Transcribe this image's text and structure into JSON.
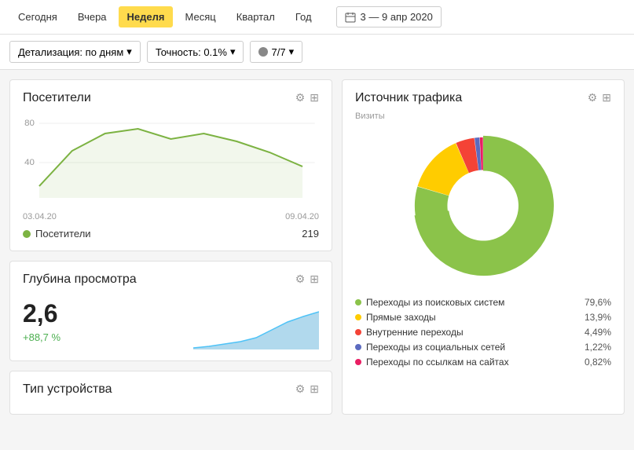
{
  "topbar": {
    "periods": [
      {
        "label": "Сегодня",
        "active": false
      },
      {
        "label": "Вчера",
        "active": false
      },
      {
        "label": "Неделя",
        "active": true
      },
      {
        "label": "Месяц",
        "active": false
      },
      {
        "label": "Квартал",
        "active": false
      },
      {
        "label": "Год",
        "active": false
      }
    ],
    "dateRange": "3 — 9 апр 2020"
  },
  "secondbar": {
    "detail": "Детализация: по дням",
    "accuracy": "Точность: 0.1%",
    "sites": "7/7"
  },
  "visitors": {
    "title": "Посетители",
    "count": "219",
    "legendLabel": "Посетители",
    "dateStart": "03.04.20",
    "dateEnd": "09.04.20",
    "yLabels": [
      "80",
      "40"
    ],
    "chartData": [
      20,
      45,
      65,
      72,
      60,
      65,
      55,
      45,
      35
    ]
  },
  "depth": {
    "title": "Глубина просмотра",
    "value": "2,6",
    "change": "+88,7 %"
  },
  "deviceType": {
    "title": "Тип устройства"
  },
  "traffic": {
    "title": "Источник трафика",
    "subtitle": "Визиты",
    "legend": [
      {
        "label": "Переходы из поисковых систем",
        "value": "79,6%",
        "color": "#8bc34a"
      },
      {
        "label": "Прямые заходы",
        "value": "13,9%",
        "color": "#ffcc00"
      },
      {
        "label": "Внутренние переходы",
        "value": "4,49%",
        "color": "#f44336"
      },
      {
        "label": "Переходы из социальных сетей",
        "value": "1,22%",
        "color": "#5c6bc0"
      },
      {
        "label": "Переходы по ссылкам на сайтах",
        "value": "0,82%",
        "color": "#e91e63"
      }
    ],
    "donut": {
      "segments": [
        {
          "pct": 79.6,
          "color": "#8bc34a"
        },
        {
          "pct": 13.9,
          "color": "#ffcc00"
        },
        {
          "pct": 4.49,
          "color": "#f44336"
        },
        {
          "pct": 1.22,
          "color": "#5c6bc0"
        },
        {
          "pct": 0.82,
          "color": "#e91e63"
        }
      ]
    }
  },
  "icons": {
    "gear": "⚙",
    "grid": "⊞",
    "chevron": "▾",
    "calendar": "📅"
  }
}
